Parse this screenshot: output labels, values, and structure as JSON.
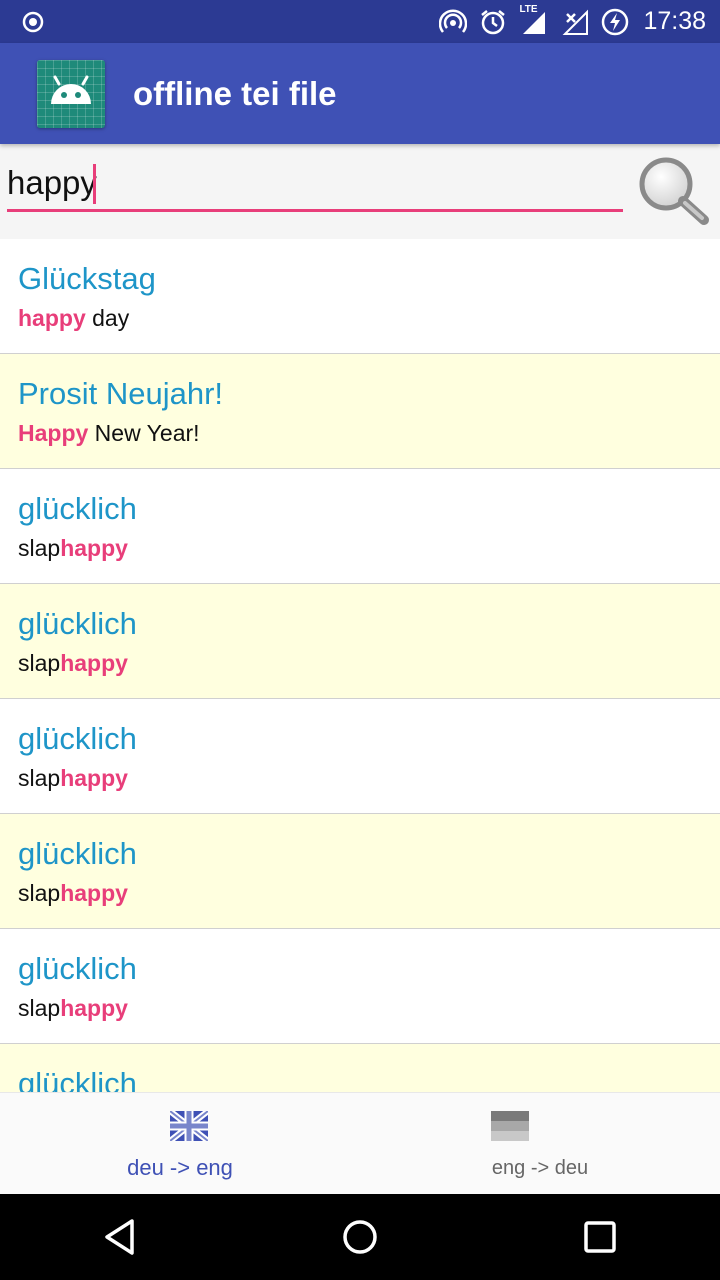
{
  "status_bar": {
    "time": "17:38",
    "network_label": "LTE",
    "icons": [
      "notification-dot-icon",
      "hotspot-icon",
      "alarm-icon",
      "lte-signal-icon",
      "no-signal-icon",
      "battery-charging-icon"
    ]
  },
  "app_bar": {
    "title": "offline tei file",
    "icon": "android-icon"
  },
  "search": {
    "value": "happy",
    "placeholder": "",
    "button_icon": "magnifier-icon"
  },
  "results": [
    {
      "headword": "Glückstag",
      "before": "",
      "match": "happy",
      "after": " day"
    },
    {
      "headword": "Prosit Neujahr!",
      "before": "",
      "match": "Happy",
      "after": " New Year!"
    },
    {
      "headword": "glücklich",
      "before": "slap",
      "match": "happy",
      "after": ""
    },
    {
      "headword": "glücklich",
      "before": "slap",
      "match": "happy",
      "after": ""
    },
    {
      "headword": "glücklich",
      "before": "slap",
      "match": "happy",
      "after": ""
    },
    {
      "headword": "glücklich",
      "before": "slap",
      "match": "happy",
      "after": ""
    },
    {
      "headword": "glücklich",
      "before": "slap",
      "match": "happy",
      "after": ""
    },
    {
      "headword": "glücklich",
      "before": "",
      "match": "",
      "after": ""
    }
  ],
  "bottom_nav": {
    "tabs": [
      {
        "label": "deu -> eng",
        "icon": "uk-flag-icon",
        "active": true
      },
      {
        "label": "eng -> deu",
        "icon": "german-flag-icon",
        "active": false
      }
    ]
  },
  "colors": {
    "status_bar": "#2c3a93",
    "app_bar": "#3f51b5",
    "accent": "#e83e7a",
    "headword": "#1e95c8",
    "alt_row": "#ffffdf"
  }
}
